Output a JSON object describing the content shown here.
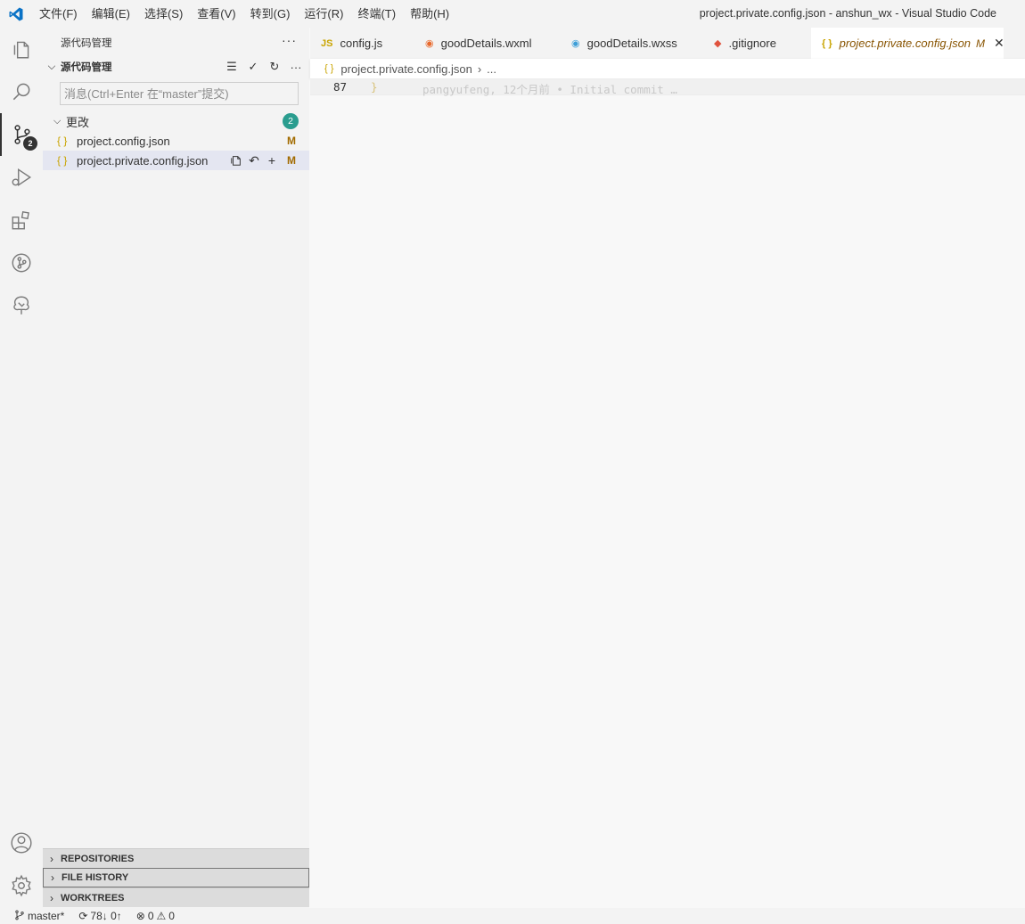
{
  "window": {
    "title": "project.private.config.json - anshun_wx - Visual Studio Code"
  },
  "menu": [
    "文件(F)",
    "编辑(E)",
    "选择(S)",
    "查看(V)",
    "转到(G)",
    "运行(R)",
    "终端(T)",
    "帮助(H)"
  ],
  "activity": {
    "scm_badge": "2"
  },
  "sidebar": {
    "title": "源代码管理",
    "more": "···",
    "section_title": "源代码管理",
    "commit_placeholder": "消息(Ctrl+Enter 在“master”提交)",
    "changes": {
      "label": "更改",
      "count": "2",
      "files": [
        {
          "name": "project.config.json",
          "status": "M"
        },
        {
          "name": "project.private.config.json",
          "status": "M"
        }
      ]
    },
    "bottom_sections": [
      "REPOSITORIES",
      "FILE HISTORY",
      "WORKTREES"
    ]
  },
  "tabs": [
    {
      "label": "config.js",
      "icon_text": "JS",
      "icon_color": "#c9a400"
    },
    {
      "label": "goodDetails.wxml",
      "icon_text": "◉",
      "icon_color": "#e8692c"
    },
    {
      "label": "goodDetails.wxss",
      "icon_text": "◉",
      "icon_color": "#3e9fd8"
    },
    {
      "label": ".gitignore",
      "icon_text": "◆",
      "icon_color": "#e0533e"
    },
    {
      "label": "project.private.config.json",
      "icon_text": "{ }",
      "icon_color": "#c9a400",
      "modified": "M"
    }
  ],
  "breadcrumb": {
    "file": "project.private.config.json",
    "rest": "..."
  },
  "editor": {
    "line_number": "87",
    "code": "}",
    "blame": "pangyufeng, 12个月前 • Initial commit …"
  },
  "statusbar": {
    "branch": "master*",
    "sync": "78↓ 0↑",
    "errors": "0",
    "warnings": "0"
  },
  "colors": {
    "accent": "#007acc",
    "badge": "#2a9d8f",
    "modified": "#a26b00"
  }
}
